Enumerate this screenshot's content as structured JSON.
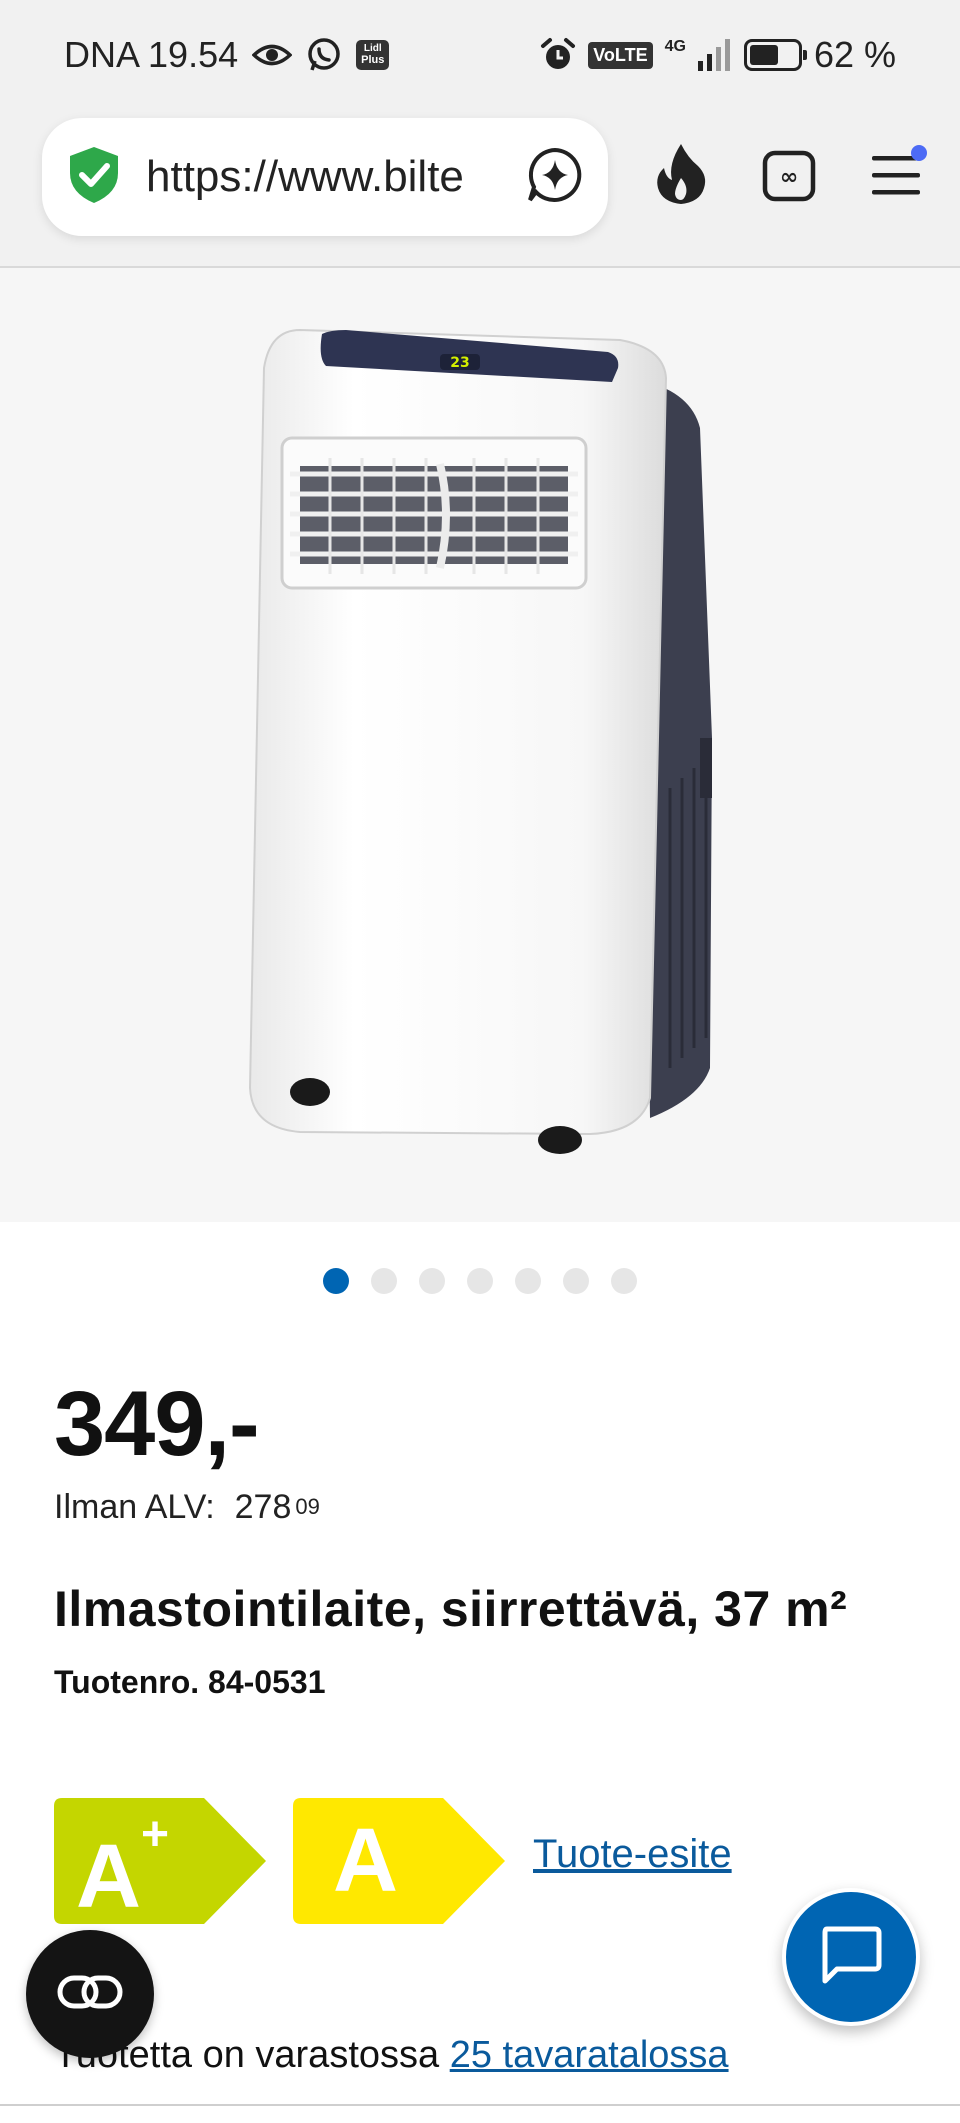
{
  "status_bar": {
    "carrier_time": "DNA 19.54",
    "app_badge_line1": "Lidl",
    "app_badge_line2": "Plus",
    "volte": "VoLTE",
    "network": "4G",
    "battery_percent": "62 %",
    "battery_level": 0.62,
    "icons": [
      "eye-icon",
      "whatsapp-icon",
      "lidl-plus-icon",
      "alarm-icon",
      "volte-icon",
      "signal-icon",
      "battery-icon"
    ]
  },
  "browser": {
    "url": "https://www.bilte",
    "icons": [
      "shield-check-icon",
      "ai-sparkle-icon",
      "fire-icon",
      "tabs-icon",
      "menu-icon"
    ],
    "accent": "#4d6bf5"
  },
  "gallery": {
    "image_alt": "Ilmastointilaite",
    "display_value": "23",
    "dot_count": 7,
    "active_index": 0
  },
  "product": {
    "price": "349,-",
    "vat_label": "Ilman ALV:",
    "vat_price_main": "278",
    "vat_price_cents": "09",
    "title": "Ilmastointilaite, siirrettävä, 37 m²",
    "sku": "Tuotenro. 84-0531"
  },
  "energy": {
    "label1_class": "A",
    "label1_sup": "+",
    "label1_color": "#c4d600",
    "label2_class": "A",
    "label2_color": "#ffe800",
    "brochure_link": "Tuote-esite"
  },
  "stock": {
    "text": "Tuotetta on varastossa",
    "link": "25 tavaratalossa"
  },
  "colors": {
    "brand_blue": "#0065b3",
    "link_blue": "#0a5a9c"
  }
}
